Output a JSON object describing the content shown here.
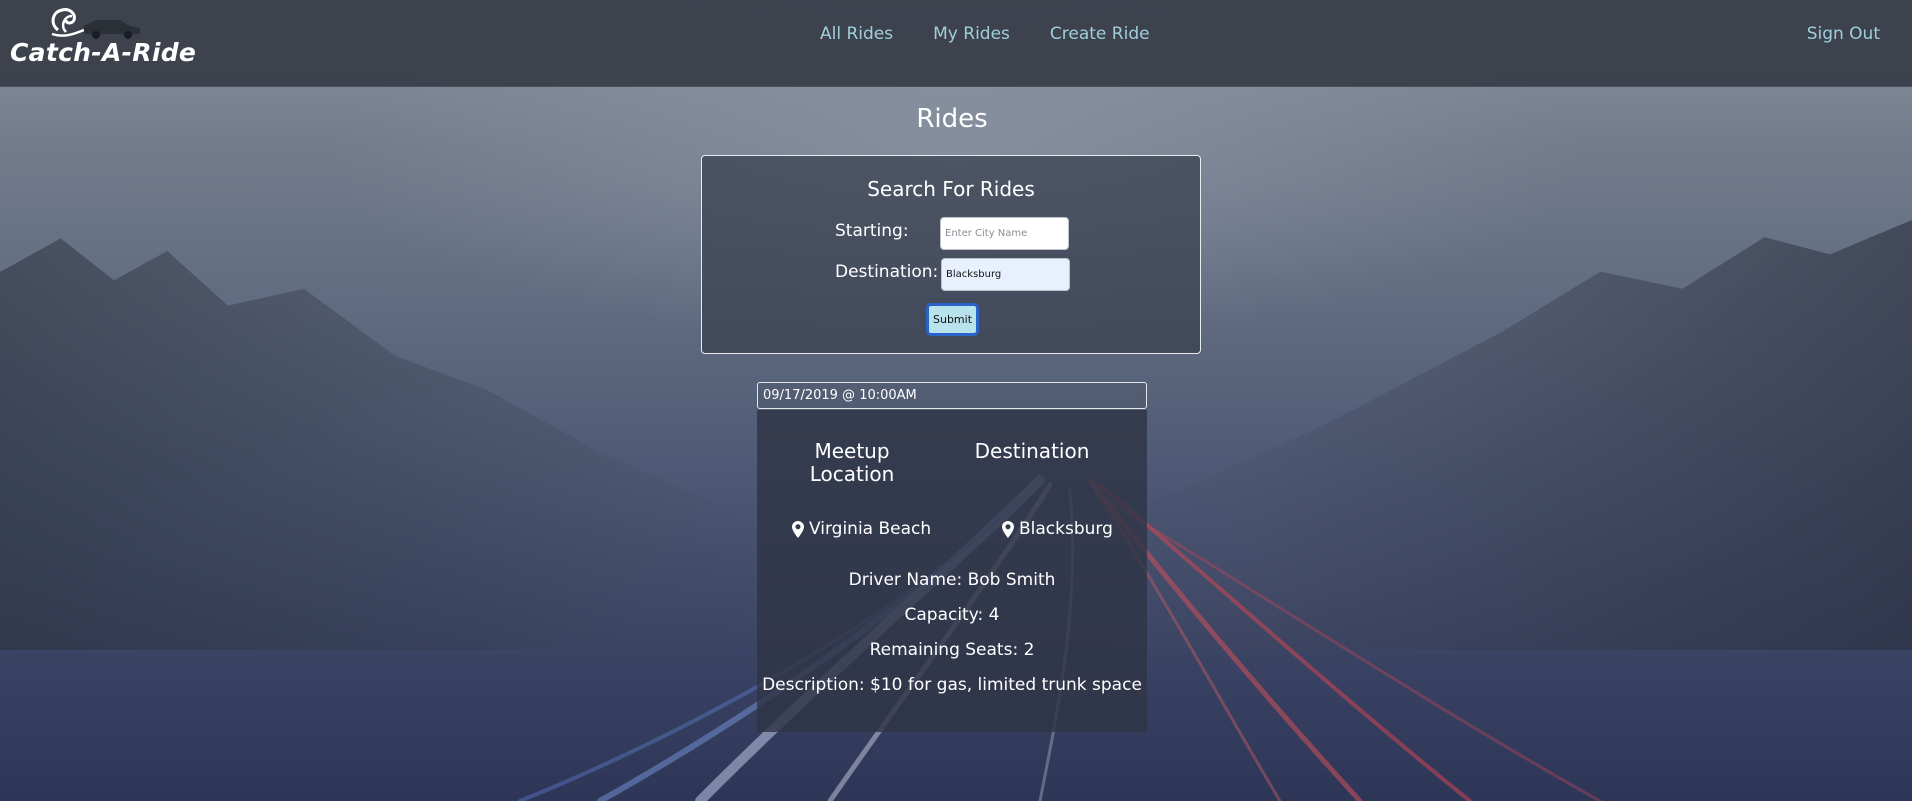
{
  "brand": {
    "name": "Catch-A-Ride",
    "logo_icon": "car-wave-logo-icon"
  },
  "nav": {
    "links": [
      "All Rides",
      "My Rides",
      "Create Ride"
    ],
    "sign_out": "Sign Out",
    "link_color": "#9fcfdc"
  },
  "page": {
    "title": "Rides"
  },
  "search": {
    "title": "Search For Rides",
    "starting_label": "Starting:",
    "starting_value": "",
    "starting_placeholder": "Enter City Name",
    "destination_label": "Destination:",
    "destination_value": "Blacksburg",
    "submit_label": "Submit"
  },
  "ride": {
    "datetime": "09/17/2019 @ 10:00AM",
    "meetup_heading": "Meetup Location",
    "destination_heading": "Destination",
    "meetup_location": "Virginia Beach",
    "destination": "Blacksburg",
    "location_icon": "map-pin-icon",
    "driver_line": "Driver Name: Bob Smith",
    "capacity_line": "Capacity: 4",
    "remaining_line": "Remaining Seats: 2",
    "description_line": "Description: $10 for gas, limited trunk space"
  }
}
